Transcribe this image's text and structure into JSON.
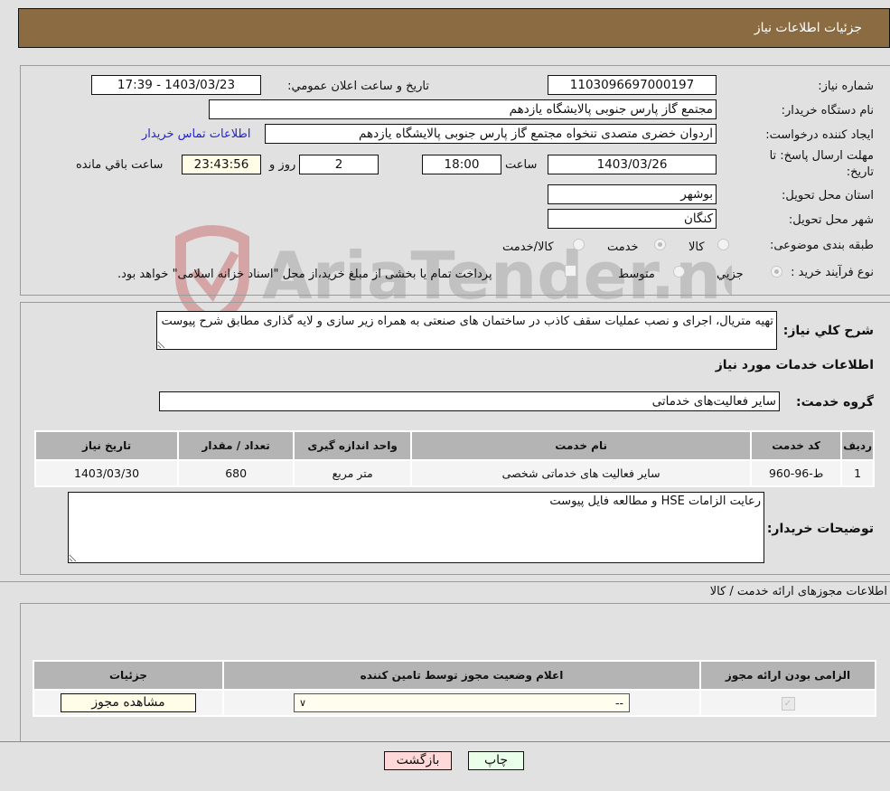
{
  "header": {
    "title": "جزئیات اطلاعات نیاز"
  },
  "form": {
    "need_number_label": "شماره نیاز:",
    "need_number": "1103096697000197",
    "announce_label": "تاریخ و ساعت اعلان عمومي:",
    "announce_value": "1403/03/23 - 17:39",
    "buyer_org_label": "نام دستگاه خریدار:",
    "buyer_org": "مجتمع گاز پارس جنوبی  پالایشگاه یازدهم",
    "creator_label": "ایجاد کننده درخواست:",
    "creator": "اردوان خضری متصدی تنخواه مجتمع گاز پارس جنوبی  پالایشگاه یازدهم",
    "contact_link": "اطلاعات تماس خریدار",
    "deadline_label_1": "مهلت ارسال پاسخ: تا",
    "deadline_label_2": "تاریخ:",
    "deadline_date": "1403/03/26",
    "time_label": "ساعت",
    "deadline_time": "18:00",
    "days": "2",
    "days_label": "روز و",
    "remaining": "23:43:56",
    "remaining_label": "ساعت باقي مانده",
    "province_label": "استان محل تحویل:",
    "province": "بوشهر",
    "city_label": "شهر محل تحویل:",
    "city": "کنگان",
    "category_label": "طبقه بندی موضوعی:",
    "category_options": [
      "کالا",
      "خدمت",
      "کالا/خدمت"
    ],
    "category_selected": "خدمت",
    "process_label": "نوع فرآیند خرید :",
    "process_options": [
      "جزیي",
      "متوسط"
    ],
    "process_selected": "جزیي",
    "treasury_note": "پرداخت تمام یا بخشی از مبلغ خرید،از محل \"اسناد خزانه اسلامی\" خواهد بود."
  },
  "description": {
    "label": "شرح کلي نیاز:",
    "text": "تهیه متریال، اجرای و نصب عملیات سقف کاذب در ساختمان های صنعتی به همراه زیر سازی و لایه گذاری مطابق شرح پیوست"
  },
  "services": {
    "section_title": "اطلاعات خدمات مورد نیاز",
    "group_label": "گروه خدمت:",
    "group_value": "سایر فعالیت‌های خدماتی",
    "columns": [
      "ردیف",
      "کد خدمت",
      "نام خدمت",
      "واحد اندازه گیری",
      "تعداد / مقدار",
      "تاریخ نیاز"
    ],
    "rows": [
      [
        "1",
        "ط-96-960",
        "سایر فعالیت های خدماتی شخصی",
        "متر مربع",
        "680",
        "1403/03/30"
      ]
    ]
  },
  "buyer_notes": {
    "label": "توضیحات خریدار:",
    "text": "رعایت الزامات HSE و مطالعه فایل پیوست"
  },
  "permits": {
    "section_title": "اطلاعات مجوزهای ارائه خدمت / کالا",
    "columns": [
      "الزامی بودن ارائه مجوز",
      "اعلام وضعیت مجوز توسط تامین کننده",
      "جزئیات"
    ],
    "select_value": "--",
    "view_button": "مشاهده مجوز"
  },
  "footer": {
    "print_label": "چاپ",
    "back_label": "بازگشت"
  },
  "watermark": {
    "text": "AriaTender.neT"
  }
}
